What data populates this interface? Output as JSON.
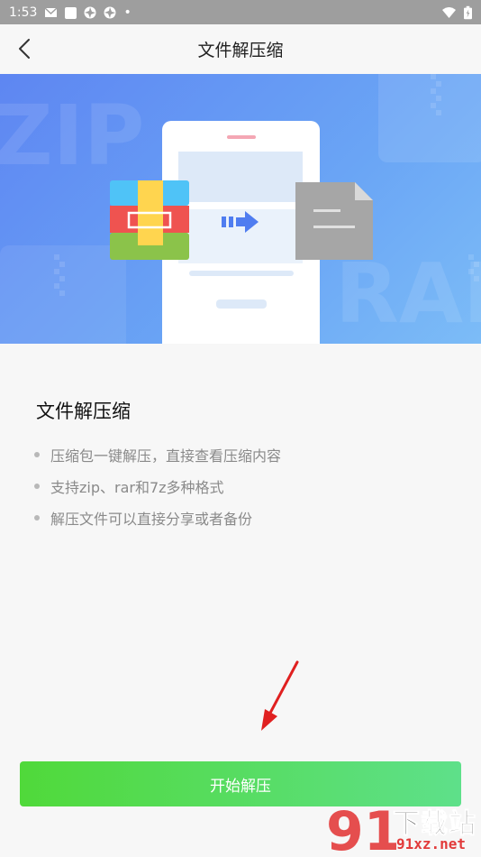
{
  "status_bar": {
    "time": "1:53",
    "dot": "•"
  },
  "header": {
    "title": "文件解压缩"
  },
  "banner": {
    "bg_text_left": "ZIP",
    "bg_text_right": "RAI",
    "colors": {
      "background": "#6a9cf4",
      "phone": "#ffffff",
      "archive_blue": "#4fc3f7",
      "archive_red": "#ef5350",
      "archive_green": "#8bc34a",
      "archive_band": "#ffd54f",
      "arrow": "#4f7df0",
      "file": "#a6a6a6"
    }
  },
  "content": {
    "title": "文件解压缩",
    "features": [
      "压缩包一键解压，直接查看压缩内容",
      "支持zip、rar和7z多种格式",
      "解压文件可以直接分享或者备份"
    ]
  },
  "actions": {
    "start_label": "开始解压"
  },
  "watermark": {
    "logo_text": "91",
    "site_cn": "下载站",
    "site_url": "91xz.net"
  }
}
